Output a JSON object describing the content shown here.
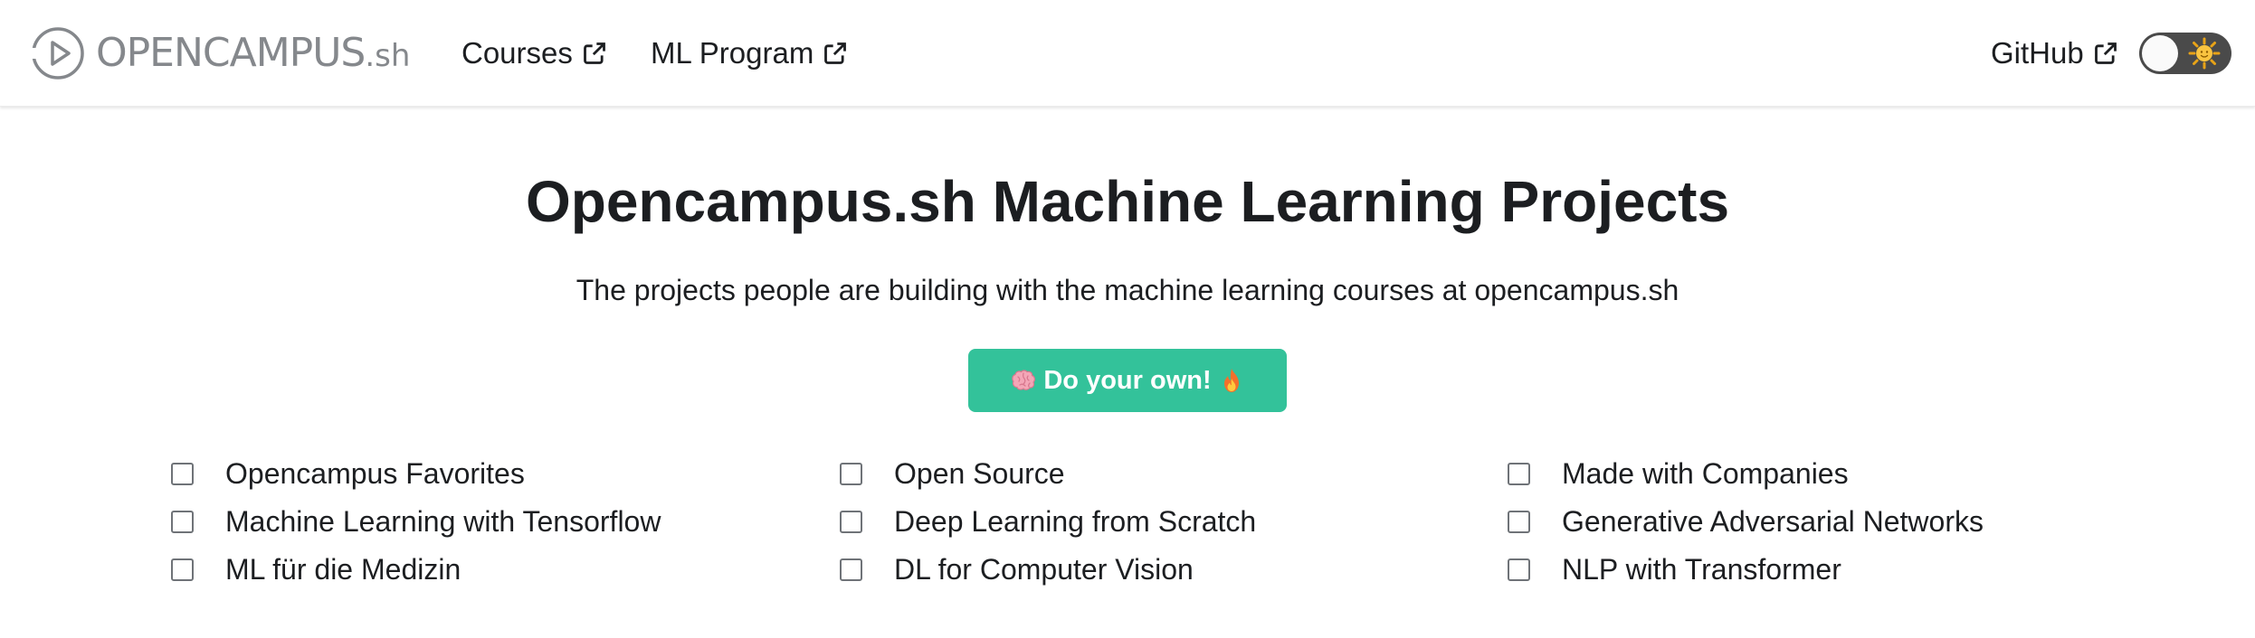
{
  "navbar": {
    "brand": {
      "name": "OPENCAMPUS",
      "suffix": ".sh"
    },
    "links": {
      "courses": "Courses",
      "ml_program": "ML Program",
      "github": "GitHub"
    },
    "theme_toggle": {
      "state": "light",
      "icon": "sun-icon"
    }
  },
  "hero": {
    "title": "Opencampus.sh Machine Learning Projects",
    "subtitle": "The projects people are building with the machine learning courses at opencampus.sh",
    "cta": {
      "label": "Do your own!",
      "leading_icon": "brain-icon",
      "trailing_icon": "fire-icon"
    }
  },
  "filters": [
    {
      "label": "Opencampus Favorites",
      "checked": false
    },
    {
      "label": "Open Source",
      "checked": false
    },
    {
      "label": "Made with Companies",
      "checked": false
    },
    {
      "label": "Machine Learning with Tensorflow",
      "checked": false
    },
    {
      "label": "Deep Learning from Scratch",
      "checked": false
    },
    {
      "label": "Generative Adversarial Networks",
      "checked": false
    },
    {
      "label": "ML für die Medizin",
      "checked": false
    },
    {
      "label": "DL for Computer Vision",
      "checked": false
    },
    {
      "label": "NLP with Transformer",
      "checked": false
    }
  ],
  "colors": {
    "accent": "#33c29a",
    "text": "#1c1e21",
    "brand_gray": "#85888c",
    "toggle_track": "#4a4a4a"
  }
}
